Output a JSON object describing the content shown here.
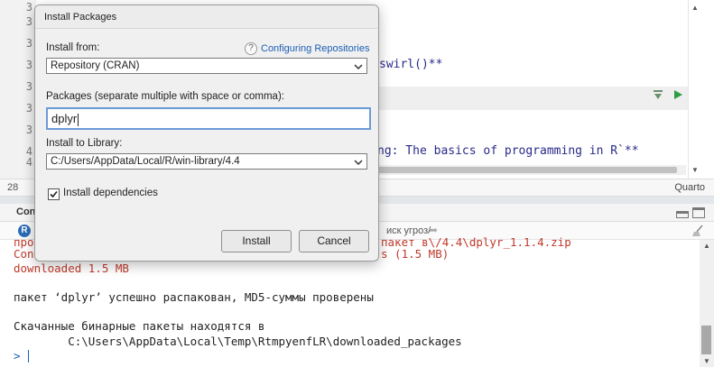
{
  "editor": {
    "line_numbers": [
      "3",
      "3",
      "3",
      "3",
      "3",
      "3",
      "3",
      "4",
      "4"
    ],
    "code_line_swirl": "swirl()**",
    "code_line_basics": "ng: The basics of programming in R`**",
    "cursor_position": "28",
    "doc_type": "Quarto"
  },
  "console": {
    "title": "Con",
    "toolbar_text": "иск угроз/",
    "lines": {
      "line_1_left": "про",
      "line_1_right": "пакет в\\/4.4\\dplyr_1.1.4.zip",
      "line_2_left": "Con",
      "line_2_right": "s (1.5 MB)",
      "line_3": "downloaded 1.5 MB",
      "line_4": "пакет ‘dplyr’ успешно распакован, MD5-суммы проверены",
      "line_5": "Скачанные бинарные пакеты находятся в",
      "line_6": "        C:\\Users\\AppData\\Local\\Temp\\RtmpyenfLR\\downloaded_packages",
      "prompt": ">"
    }
  },
  "dialog": {
    "title": "Install Packages",
    "install_from_label": "Install from:",
    "help_link": "Configuring Repositories",
    "install_from_value": "Repository (CRAN)",
    "packages_label": "Packages (separate multiple with space or comma):",
    "packages_value": "dplyr",
    "library_label": "Install to Library:",
    "library_value": "C:/Users/AppData/Local/R/win-library/4.4",
    "dependencies_label": "Install dependencies",
    "dependencies_checked": true,
    "install_button": "Install",
    "cancel_button": "Cancel"
  },
  "colors": {
    "accent": "#1a5fb4",
    "console_output": "#c0392b",
    "run_chunk": "#2e9e44"
  },
  "icons": [
    "help-icon",
    "chevron-down-icon",
    "checkmark-icon",
    "r-logo-icon",
    "broom-icon",
    "run-chunk-icon",
    "chunk-settings-icon",
    "forward-arrow-icon",
    "minimize-icon",
    "maximize-icon"
  ]
}
